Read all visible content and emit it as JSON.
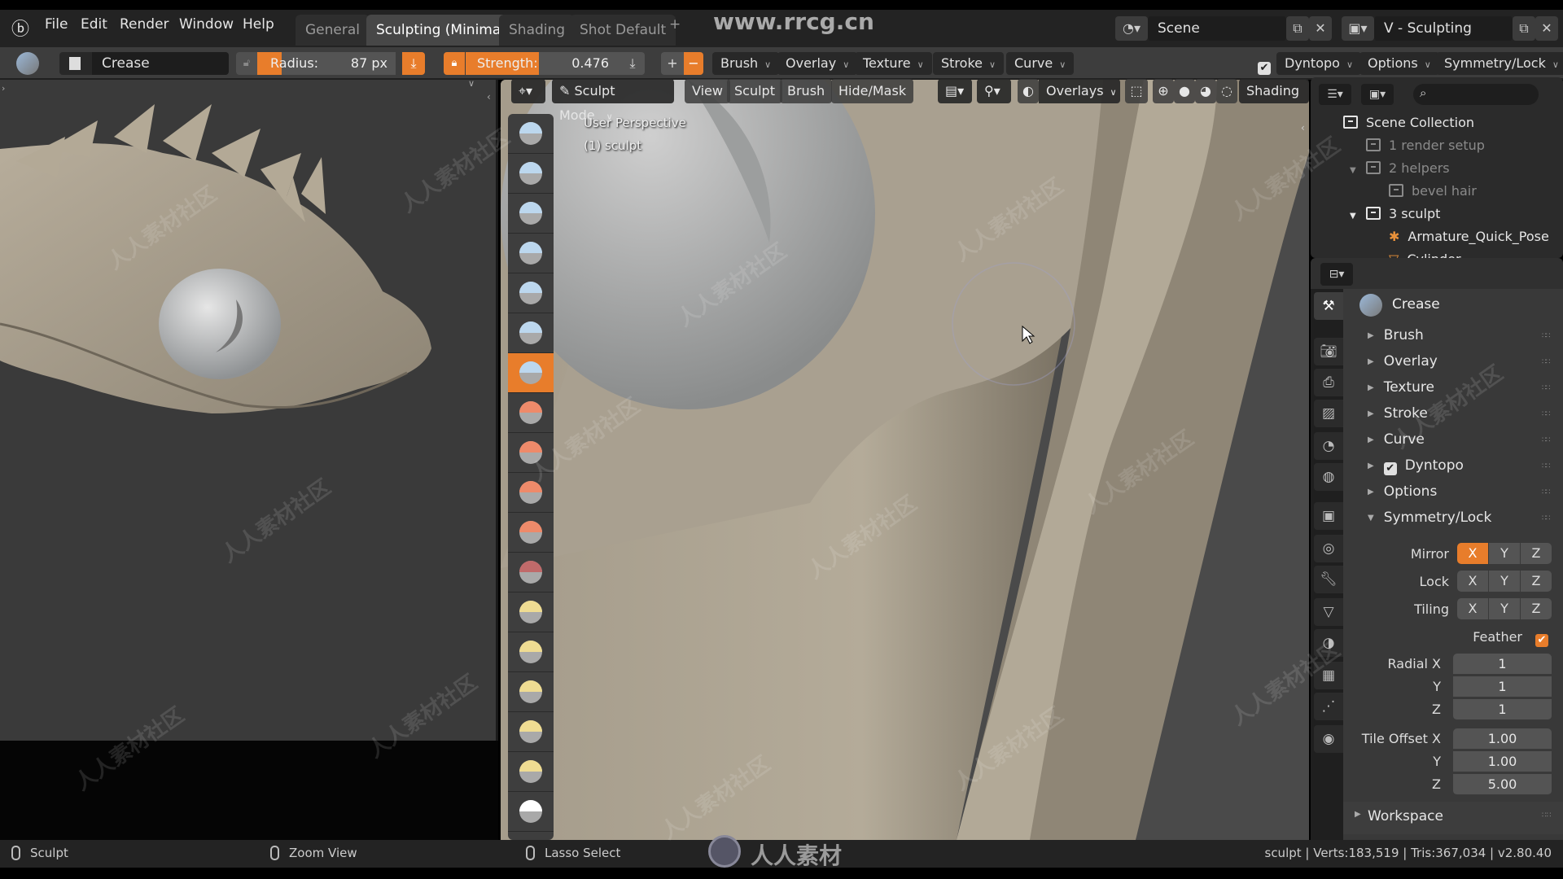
{
  "top_menu": {
    "items": [
      "File",
      "Edit",
      "Render",
      "Window",
      "Help"
    ],
    "workspace_tabs": [
      {
        "label": "General",
        "active": false
      },
      {
        "label": "Sculpting (Minimal)",
        "active": true
      },
      {
        "label": "Shading",
        "active": false
      },
      {
        "label": "Shot Default",
        "active": false
      }
    ],
    "add_tab_label": "+",
    "watermark_url": "www.rrcg.cn",
    "scene_label": "Scene",
    "view_layer_label": "V - Sculpting"
  },
  "tool_header": {
    "brush_name": "Crease",
    "radius_label": "Radius:",
    "radius_value": "87 px",
    "strength_label": "Strength:",
    "strength_value": "0.476",
    "plus_label": "+",
    "minus_label": "−",
    "menus": [
      "Brush",
      "Overlay",
      "Texture",
      "Stroke",
      "Curve"
    ],
    "dyntopo_label": "Dyntopo",
    "dyntopo_checked": true,
    "options_label": "Options",
    "symmetry_label": "Symmetry/Lock"
  },
  "viewport": {
    "mode_label": "Sculpt Mode",
    "menus": [
      "View",
      "Sculpt",
      "Brush",
      "Hide/Mask"
    ],
    "overlays_label": "Overlays",
    "shading_label": "Shading",
    "perspective_text": "User Perspective",
    "object_text": "(1) sculpt",
    "active_shading": "solid"
  },
  "toolbar": {
    "tools": [
      {
        "name": "draw",
        "color": "#bcd7ee"
      },
      {
        "name": "clay",
        "color": "#bcd7ee"
      },
      {
        "name": "clay-strips",
        "color": "#bcd7ee"
      },
      {
        "name": "layer",
        "color": "#bcd7ee"
      },
      {
        "name": "inflate",
        "color": "#bcd7ee"
      },
      {
        "name": "blob",
        "color": "#bcd7ee"
      },
      {
        "name": "crease",
        "color": "#bcd7ee",
        "active": true
      },
      {
        "name": "smooth",
        "color": "#ee8a6a"
      },
      {
        "name": "flatten",
        "color": "#ee8a6a"
      },
      {
        "name": "fill",
        "color": "#ee8a6a"
      },
      {
        "name": "scrape",
        "color": "#ee8a6a"
      },
      {
        "name": "pinch",
        "color": "#c06a6a"
      },
      {
        "name": "grab",
        "color": "#efdc92"
      },
      {
        "name": "snake-hook",
        "color": "#efdc92"
      },
      {
        "name": "thumb",
        "color": "#efdc92"
      },
      {
        "name": "rotate",
        "color": "#efdc92"
      },
      {
        "name": "nudge",
        "color": "#efdc92"
      },
      {
        "name": "mask",
        "color": "#ffffff"
      }
    ]
  },
  "outliner": {
    "search_placeholder": "",
    "items": [
      {
        "label": "Scene Collection",
        "indent": 0,
        "dim": false,
        "expander": ""
      },
      {
        "label": "1 render setup",
        "indent": 1,
        "dim": true,
        "expander": ""
      },
      {
        "label": "2 helpers",
        "indent": 1,
        "dim": true,
        "expander": "▼"
      },
      {
        "label": "bevel hair",
        "indent": 2,
        "dim": true,
        "expander": ""
      },
      {
        "label": "3 sculpt",
        "indent": 1,
        "dim": false,
        "expander": "▼"
      },
      {
        "label": "Armature_Quick_Pose",
        "indent": 2,
        "dim": false,
        "expander": "",
        "icon": "armature"
      },
      {
        "label": "Cylinder",
        "indent": 2,
        "dim": false,
        "expander": "",
        "icon": "mesh"
      }
    ]
  },
  "properties": {
    "brush_name": "Crease",
    "panels": [
      {
        "label": "Brush",
        "expanded": false
      },
      {
        "label": "Overlay",
        "expanded": false
      },
      {
        "label": "Texture",
        "expanded": false
      },
      {
        "label": "Stroke",
        "expanded": false
      },
      {
        "label": "Curve",
        "expanded": false
      },
      {
        "label": "Dyntopo",
        "expanded": false,
        "checkbox": true
      },
      {
        "label": "Options",
        "expanded": false
      },
      {
        "label": "Symmetry/Lock",
        "expanded": true
      }
    ],
    "symmetry": {
      "mirror_label": "Mirror",
      "mirror": {
        "X": true,
        "Y": false,
        "Z": false
      },
      "lock_label": "Lock",
      "lock": {
        "X": false,
        "Y": false,
        "Z": false
      },
      "tiling_label": "Tiling",
      "tiling": {
        "X": false,
        "Y": false,
        "Z": false
      },
      "feather_label": "Feather",
      "feather_checked": true,
      "radial_label": "Radial X",
      "radial": [
        "1",
        "1",
        "1"
      ],
      "tile_offset_label": "Tile Offset X",
      "tile_offset": [
        "1.00",
        "1.00",
        "5.00"
      ],
      "axis_y": "Y",
      "axis_z": "Z"
    },
    "workspace_label": "Workspace"
  },
  "status_bar": {
    "left_hint": "Sculpt",
    "middle_hint": "Zoom View",
    "right_hint": "Lasso Select",
    "logo_text": "人人素材",
    "stats": "sculpt | Verts:183,519 | Tris:367,034 | v2.80.40"
  },
  "watermark_text": "人人素材社区",
  "colors": {
    "accent": "#e87d2b",
    "header_bg": "#3d3d3d",
    "panel_bg": "#393939",
    "clay": "#a59c8c"
  }
}
